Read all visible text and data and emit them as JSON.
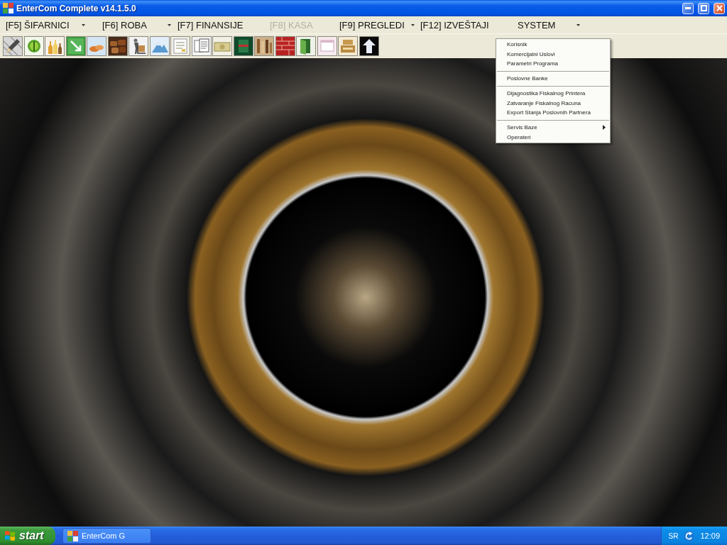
{
  "window": {
    "title": "EnterCom Complete v14.1.5.0",
    "controls": [
      {
        "kind": "minimize"
      },
      {
        "kind": "maximize"
      },
      {
        "kind": "close"
      }
    ]
  },
  "menu_bar": [
    {
      "label": "[F5] ŠIFARNICI",
      "disabled": false,
      "arrow": true
    },
    {
      "label": "[F6] ROBA",
      "disabled": false,
      "arrow": true
    },
    {
      "label": "[F7] FINANSIJE",
      "disabled": false,
      "arrow": false
    },
    {
      "label": "[F8] KASA",
      "disabled": true,
      "arrow": false
    },
    {
      "label": "[F9] PREGLEDI",
      "disabled": false,
      "arrow": true
    },
    {
      "label": "[F12] IZVEŠTAJI",
      "disabled": false,
      "arrow": false
    },
    {
      "label": "SYSTEM",
      "disabled": false,
      "arrow": true
    }
  ],
  "toolbar": [
    {
      "kind": "pencil"
    },
    {
      "kind": "coin"
    },
    {
      "kind": "bottles"
    },
    {
      "kind": "arrow_tile"
    },
    {
      "kind": "bread"
    },
    {
      "kind": "crates"
    },
    {
      "kind": "porter"
    },
    {
      "kind": "mountain"
    },
    {
      "kind": "form"
    },
    {
      "kind": "papers"
    },
    {
      "kind": "banknote"
    },
    {
      "kind": "book"
    },
    {
      "kind": "shelf"
    },
    {
      "kind": "bricks"
    },
    {
      "kind": "door"
    },
    {
      "kind": "window"
    },
    {
      "kind": "register"
    },
    {
      "kind": "upload"
    }
  ],
  "system_menu": {
    "items": [
      {
        "kind": "item",
        "label": "Korisnik"
      },
      {
        "kind": "item",
        "label": "Komercijalni Uslovi"
      },
      {
        "kind": "item",
        "label": "Parametri Programa"
      },
      {
        "kind": "separator"
      },
      {
        "kind": "item",
        "label": "Poslovne Banke"
      },
      {
        "kind": "separator"
      },
      {
        "kind": "item",
        "label": "Dijagnostika Fiskalnog Printera"
      },
      {
        "kind": "item",
        "label": "Zatvaranje Fiskalnog Racuna"
      },
      {
        "kind": "item",
        "label": "Export Stanja Poslovnih Partnera"
      },
      {
        "kind": "separator"
      },
      {
        "kind": "submenu",
        "label": "Servis Baze"
      },
      {
        "kind": "item",
        "label": "Operateri"
      }
    ]
  },
  "taskbar": {
    "start_button": "start",
    "tasks": [
      {
        "label": "EnterCom G"
      }
    ],
    "tray": {
      "language": "SR",
      "time": "12:09"
    }
  }
}
